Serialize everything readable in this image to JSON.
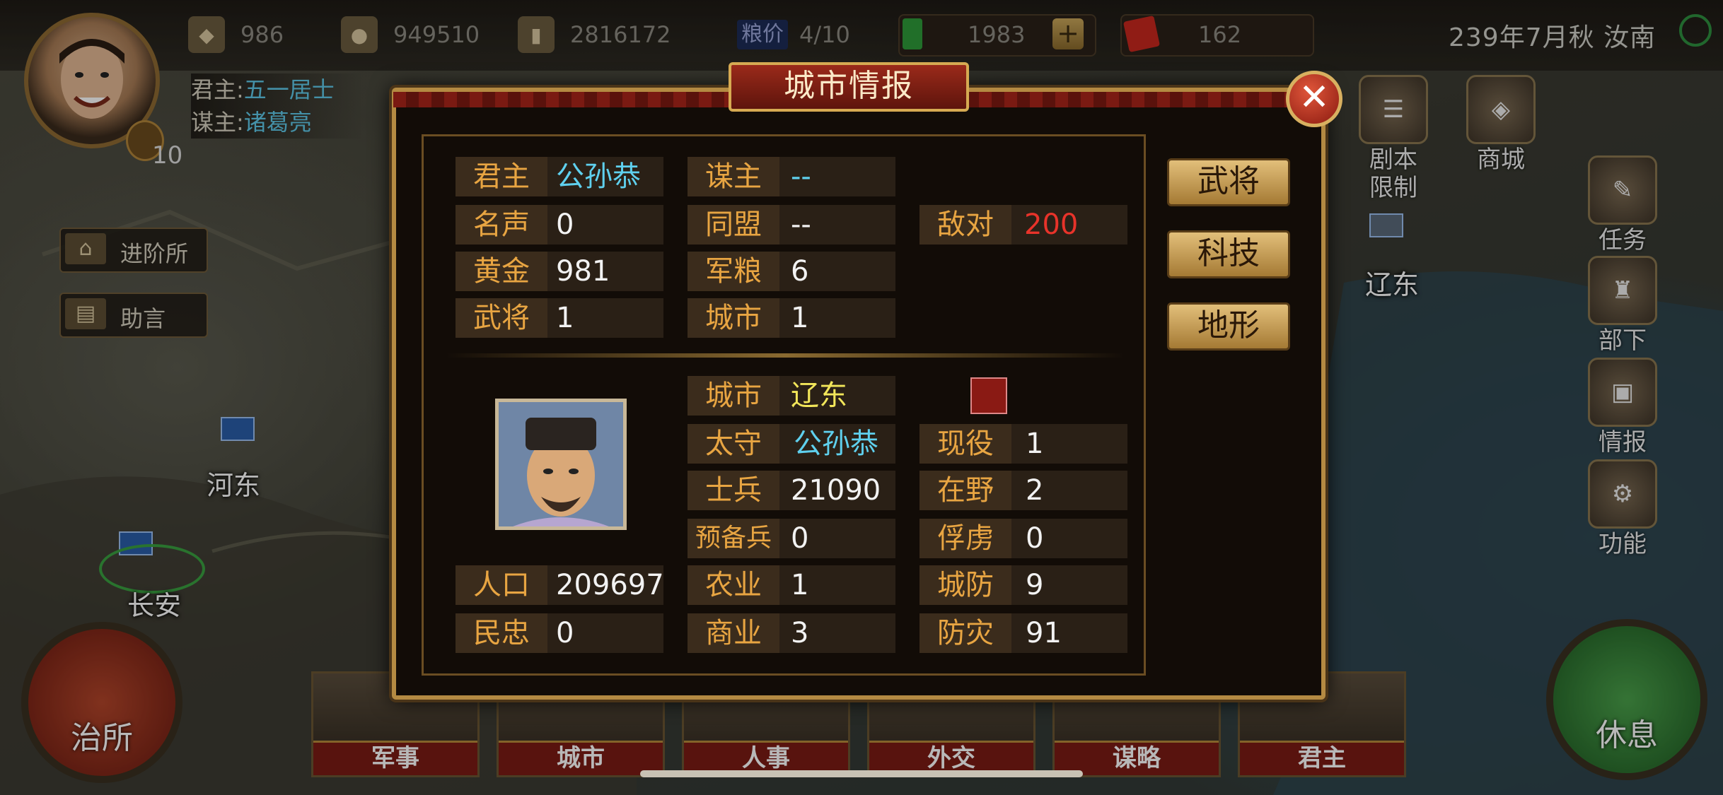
{
  "resources": [
    {
      "icon": "gold-ingot-icon",
      "value": "986"
    },
    {
      "icon": "coin-icon",
      "value": "949510"
    },
    {
      "icon": "wood-icon",
      "value": "2816172"
    }
  ],
  "grain_price": {
    "label": "粮价",
    "value": "4/10"
  },
  "currency": [
    {
      "icon": "jade-icon",
      "value": "1983"
    },
    {
      "icon": "ticket-icon",
      "value": "162"
    }
  ],
  "plus_label": "+",
  "date_location": "239年7月秋 汝南",
  "player": {
    "level": "10",
    "lord_key": "君主:",
    "lord_val": "五一居士",
    "advisor_key": "谋主:",
    "advisor_val": "诸葛亮"
  },
  "side_buttons": [
    "进阶所",
    "助言"
  ],
  "map_labels": [
    "河东",
    "长安",
    "辽东"
  ],
  "right_menu": [
    {
      "label": "剧本\n限制",
      "icon": "scroll-icon"
    },
    {
      "label": "商城",
      "icon": "shop-icon"
    },
    {
      "label": "任务",
      "icon": "quest-icon"
    },
    {
      "label": "部下",
      "icon": "subordinate-icon"
    },
    {
      "label": "情报",
      "icon": "intel-icon"
    },
    {
      "label": "功能",
      "icon": "gear-icon"
    }
  ],
  "left_round": "治所",
  "right_round": "休息",
  "bottom_tabs": [
    "军事",
    "城市",
    "人事",
    "外交",
    "谋略",
    "君主"
  ],
  "dialog": {
    "title": "城市情报",
    "close": "✕",
    "buttons": [
      "武将",
      "科技",
      "地形"
    ],
    "faction": {
      "lord": {
        "label": "君主",
        "value": "公孙恭"
      },
      "advisor": {
        "label": "谋主",
        "value": "--"
      },
      "fame": {
        "label": "名声",
        "value": "0"
      },
      "alliance": {
        "label": "同盟",
        "value": "--"
      },
      "hostile": {
        "label": "敌对",
        "value": "200"
      },
      "gold": {
        "label": "黄金",
        "value": "981"
      },
      "grain": {
        "label": "军粮",
        "value": "6"
      },
      "generals": {
        "label": "武将",
        "value": "1"
      },
      "cities": {
        "label": "城市",
        "value": "1"
      }
    },
    "city": {
      "city": {
        "label": "城市",
        "value": "辽东"
      },
      "governor": {
        "label": "太守",
        "value": "公孙恭"
      },
      "active": {
        "label": "现役",
        "value": "1"
      },
      "soldiers": {
        "label": "士兵",
        "value": "21090"
      },
      "wild": {
        "label": "在野",
        "value": "2"
      },
      "reserve": {
        "label": "预备兵",
        "value": "0"
      },
      "captives": {
        "label": "俘虏",
        "value": "0"
      },
      "population": {
        "label": "人口",
        "value": "209697"
      },
      "agriculture": {
        "label": "农业",
        "value": "1"
      },
      "defense": {
        "label": "城防",
        "value": "9"
      },
      "loyalty": {
        "label": "民忠",
        "value": "0"
      },
      "commerce": {
        "label": "商业",
        "value": "3"
      },
      "disaster": {
        "label": "防灾",
        "value": "91"
      }
    }
  },
  "colors": {
    "label_orange": "#e8a542",
    "cyan": "#5fd0ee",
    "red": "#e8332a",
    "yellow": "#f2e65a",
    "frame_gold": "#b48a42"
  }
}
